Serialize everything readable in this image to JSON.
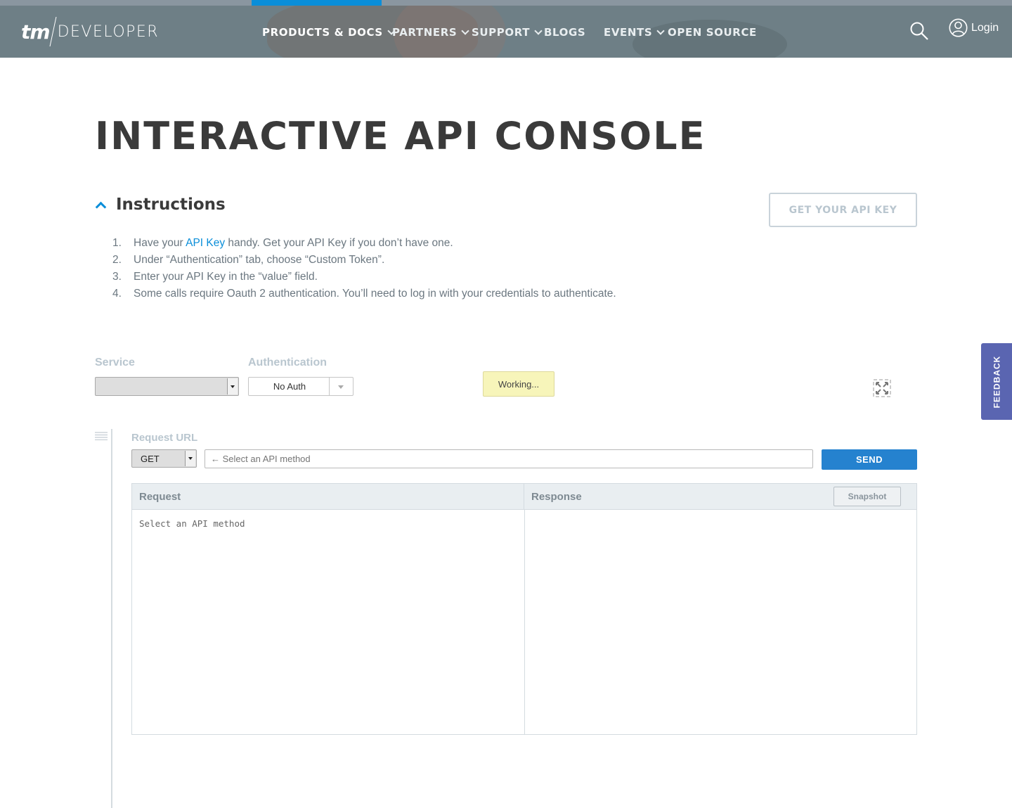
{
  "brand": {
    "logo_tm": "tm",
    "logo_developer": "DEVELOPER"
  },
  "nav": {
    "items": [
      {
        "label": "PRODUCTS & DOCS",
        "has_dropdown": true,
        "active": true
      },
      {
        "label": "PARTNERS",
        "has_dropdown": true
      },
      {
        "label": "SUPPORT",
        "has_dropdown": true
      },
      {
        "label": "BLOGS",
        "has_dropdown": false
      },
      {
        "label": "EVENTS",
        "has_dropdown": true
      },
      {
        "label": "OPEN SOURCE",
        "has_dropdown": false
      }
    ],
    "login_label": "Login",
    "search_icon": "search-icon",
    "user_icon": "user-circle-icon"
  },
  "page": {
    "title": "INTERACTIVE API CONSOLE"
  },
  "instructions": {
    "title": "Instructions",
    "api_key_button": "GET YOUR API KEY",
    "steps": [
      {
        "num": "1.",
        "prefix": "Have your ",
        "link": "API Key",
        "suffix": " handy. Get your API Key if you don’t have one."
      },
      {
        "num": "2.",
        "text": "Under “Authentication” tab, choose “Custom Token”."
      },
      {
        "num": "3.",
        "text": "Enter your API Key in the “value” field."
      },
      {
        "num": "4.",
        "text": "Some calls require Oauth 2 authentication. You’ll need to log in with your credentials to authenticate."
      }
    ]
  },
  "feedback": {
    "label": "FEEDBACK"
  },
  "console": {
    "service_label": "Service",
    "service_value": "",
    "auth_label": "Authentication",
    "auth_value": "No Auth",
    "working_label": "Working...",
    "request_url_label": "Request URL",
    "method_value": "GET",
    "url_placeholder": "← Select an API method",
    "send_label": "SEND",
    "request_header": "Request",
    "response_header": "Response",
    "snapshot_label": "Snapshot",
    "request_body": "Select an API method"
  },
  "colors": {
    "accent": "#0a8ed9",
    "header_bg": "#6e7f86",
    "send": "#2582cf",
    "feedback": "#5a65b1",
    "working_bg": "#f7f5ba"
  }
}
